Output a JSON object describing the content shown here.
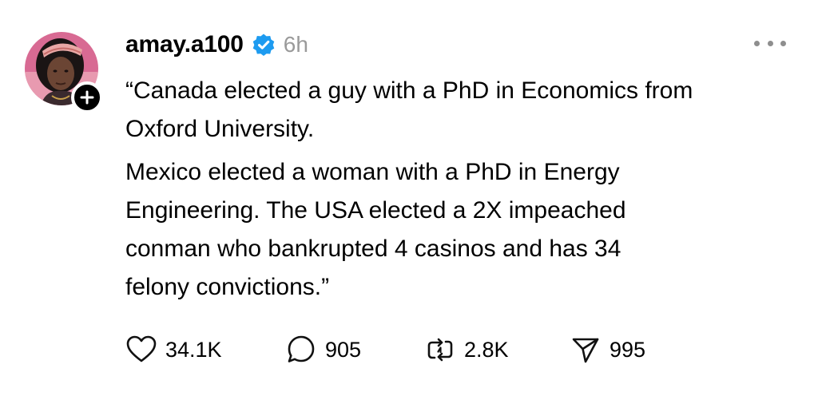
{
  "post": {
    "username": "amay.a100",
    "time": "6h",
    "paragraphs": [
      "“Canada elected a guy with a PhD in Economics from\nOxford University.",
      "Mexico elected a woman with a PhD in Energy\nEngineering. The USA elected a 2X impeached\nconman who bankrupted 4 casinos and has 34\nfelony convictions.”"
    ]
  },
  "actions": {
    "likes": "34.1K",
    "replies": "905",
    "reposts": "2.8K",
    "shares": "995"
  },
  "colors": {
    "verified_blue": "#1d9bf0",
    "muted": "#9a9a9a"
  },
  "icons": [
    "avatar-photo",
    "plus-icon",
    "verified-badge-icon",
    "more-icon",
    "heart-icon",
    "comment-icon",
    "repost-icon",
    "share-icon"
  ]
}
